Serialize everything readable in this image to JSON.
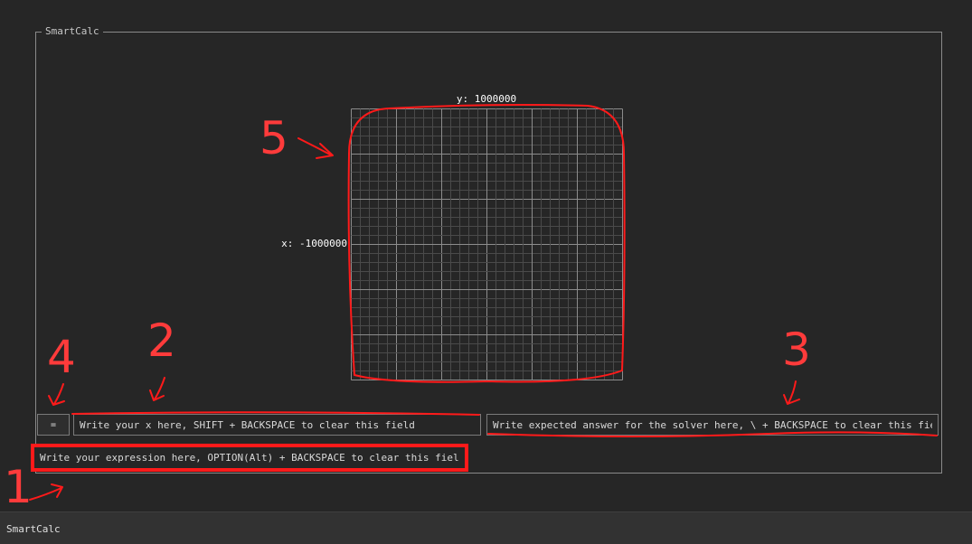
{
  "window": {
    "panel_title": "SmartCalc",
    "statusbar_title": "SmartCalc"
  },
  "graph": {
    "y_label": "y: 1000000",
    "x_label": "x: -1000000",
    "grid_major_divisions": 6,
    "grid_minor_per_major": 5
  },
  "controls": {
    "equals_label": "=",
    "x_placeholder": "Write your x here, SHIFT + BACKSPACE to clear this field",
    "answer_placeholder": "Write expected answer for the solver here, \\ + BACKSPACE to clear this field",
    "expression_placeholder": "Write your expression here, OPTION(Alt) + BACKSPACE to clear this field"
  },
  "annotations": {
    "n1": "1",
    "n2": "2",
    "n3": "3",
    "n4": "4",
    "n5": "5",
    "color": "#ff3b3b"
  },
  "colors": {
    "background": "#262626",
    "grid_major": "#8c8c8c",
    "grid_minor": "#4a4a4a",
    "highlight": "#ff1a1a"
  }
}
